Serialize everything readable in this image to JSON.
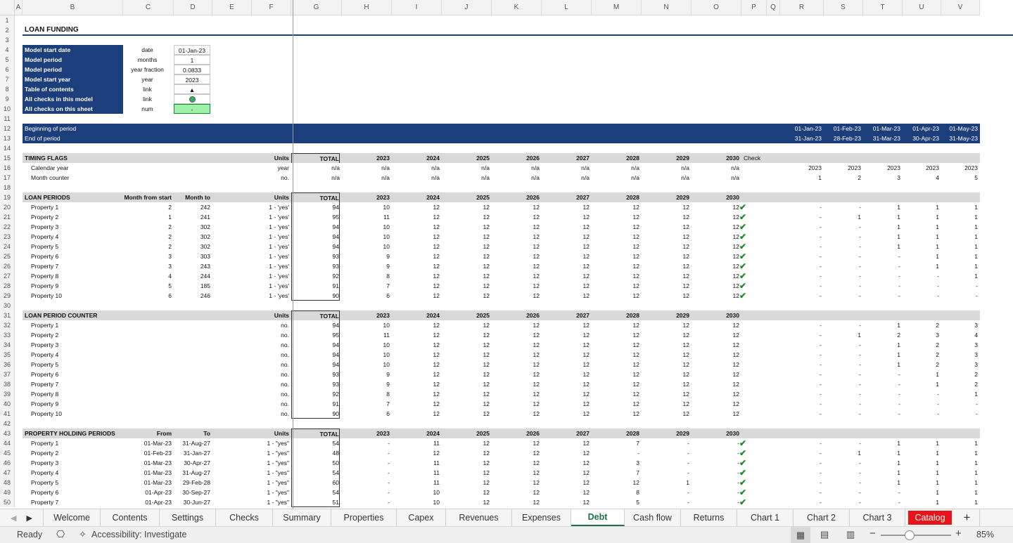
{
  "columns": [
    {
      "label": "A",
      "w": 11
    },
    {
      "label": "B",
      "w": 143
    },
    {
      "label": "C",
      "w": 72
    },
    {
      "label": "D",
      "w": 55
    },
    {
      "label": "E",
      "w": 56
    },
    {
      "label": "F",
      "w": 56
    },
    {
      "label": "G",
      "w": 72
    },
    {
      "label": "H",
      "w": 71
    },
    {
      "label": "I",
      "w": 71
    },
    {
      "label": "J",
      "w": 71
    },
    {
      "label": "K",
      "w": 71
    },
    {
      "label": "L",
      "w": 71
    },
    {
      "label": "M",
      "w": 71
    },
    {
      "label": "N",
      "w": 71
    },
    {
      "label": "O",
      "w": 71
    },
    {
      "label": "P",
      "w": 36
    },
    {
      "label": "Q",
      "w": 19
    },
    {
      "label": "R",
      "w": 62
    },
    {
      "label": "S",
      "w": 56
    },
    {
      "label": "T",
      "w": 56
    },
    {
      "label": "U",
      "w": 55
    },
    {
      "label": "V",
      "w": 55
    }
  ],
  "title": "LOAN FUNDING",
  "model_info": [
    {
      "label": "Model start date",
      "unit": "date",
      "value": "01-Jan-23"
    },
    {
      "label": "Model period",
      "unit": "months",
      "value": "1"
    },
    {
      "label": "Model period",
      "unit": "year fraction",
      "value": "0.0833"
    },
    {
      "label": "Model start year",
      "unit": "year",
      "value": "2023"
    },
    {
      "label": "Table of contents",
      "unit": "link",
      "value": "▲"
    },
    {
      "label": "All checks in this model",
      "unit": "link",
      "value": ""
    },
    {
      "label": "All checks on this sheet",
      "unit": "num",
      "value": "-"
    }
  ],
  "period_rows": {
    "begin_label": "Beginning of period",
    "end_label": "End of period",
    "begin": [
      "01-Jan-23",
      "01-Feb-23",
      "01-Mar-23",
      "01-Apr-23",
      "01-May-23"
    ],
    "end": [
      "31-Jan-23",
      "28-Feb-23",
      "31-Mar-23",
      "30-Apr-23",
      "31-May-23"
    ]
  },
  "years": [
    "2023",
    "2024",
    "2025",
    "2026",
    "2027",
    "2028",
    "2029",
    "2030"
  ],
  "labels": {
    "units": "Units",
    "total": "TOTAL",
    "check": "Check"
  },
  "timing": {
    "title": "TIMING FLAGS",
    "rows": [
      {
        "name": "Calendar year",
        "unit": "year",
        "total": "n/a",
        "vals": [
          "n/a",
          "n/a",
          "n/a",
          "n/a",
          "n/a",
          "n/a",
          "n/a",
          "n/a"
        ],
        "monthly": [
          "2023",
          "2023",
          "2023",
          "2023",
          "2023"
        ]
      },
      {
        "name": "Month counter",
        "unit": "no.",
        "total": "n/a",
        "vals": [
          "n/a",
          "n/a",
          "n/a",
          "n/a",
          "n/a",
          "n/a",
          "n/a",
          "n/a"
        ],
        "monthly": [
          "1",
          "2",
          "3",
          "4",
          "5"
        ]
      }
    ]
  },
  "loan_periods": {
    "title": "LOAN PERIODS",
    "col_c": "Month from start",
    "col_d": "Month to",
    "rows": [
      {
        "name": "Property 1",
        "c": "2",
        "d": "242",
        "unit": "1 - 'yes'",
        "total": "94",
        "vals": [
          "10",
          "12",
          "12",
          "12",
          "12",
          "12",
          "12",
          "12"
        ],
        "monthly": [
          "-",
          "-",
          "1",
          "1",
          "1"
        ]
      },
      {
        "name": "Property 2",
        "c": "1",
        "d": "241",
        "unit": "1 - 'yes'",
        "total": "95",
        "vals": [
          "11",
          "12",
          "12",
          "12",
          "12",
          "12",
          "12",
          "12"
        ],
        "monthly": [
          "-",
          "1",
          "1",
          "1",
          "1"
        ]
      },
      {
        "name": "Property 3",
        "c": "2",
        "d": "302",
        "unit": "1 - 'yes'",
        "total": "94",
        "vals": [
          "10",
          "12",
          "12",
          "12",
          "12",
          "12",
          "12",
          "12"
        ],
        "monthly": [
          "-",
          "-",
          "1",
          "1",
          "1"
        ]
      },
      {
        "name": "Property 4",
        "c": "2",
        "d": "302",
        "unit": "1 - 'yes'",
        "total": "94",
        "vals": [
          "10",
          "12",
          "12",
          "12",
          "12",
          "12",
          "12",
          "12"
        ],
        "monthly": [
          "-",
          "-",
          "1",
          "1",
          "1"
        ]
      },
      {
        "name": "Property 5",
        "c": "2",
        "d": "302",
        "unit": "1 - 'yes'",
        "total": "94",
        "vals": [
          "10",
          "12",
          "12",
          "12",
          "12",
          "12",
          "12",
          "12"
        ],
        "monthly": [
          "-",
          "-",
          "1",
          "1",
          "1"
        ]
      },
      {
        "name": "Property 6",
        "c": "3",
        "d": "303",
        "unit": "1 - 'yes'",
        "total": "93",
        "vals": [
          "9",
          "12",
          "12",
          "12",
          "12",
          "12",
          "12",
          "12"
        ],
        "monthly": [
          "-",
          "-",
          "-",
          "1",
          "1"
        ]
      },
      {
        "name": "Property 7",
        "c": "3",
        "d": "243",
        "unit": "1 - 'yes'",
        "total": "93",
        "vals": [
          "9",
          "12",
          "12",
          "12",
          "12",
          "12",
          "12",
          "12"
        ],
        "monthly": [
          "-",
          "-",
          "-",
          "1",
          "1"
        ]
      },
      {
        "name": "Property 8",
        "c": "4",
        "d": "244",
        "unit": "1 - 'yes'",
        "total": "92",
        "vals": [
          "8",
          "12",
          "12",
          "12",
          "12",
          "12",
          "12",
          "12"
        ],
        "monthly": [
          "-",
          "-",
          "-",
          "-",
          "1"
        ]
      },
      {
        "name": "Property 9",
        "c": "5",
        "d": "185",
        "unit": "1 - 'yes'",
        "total": "91",
        "vals": [
          "7",
          "12",
          "12",
          "12",
          "12",
          "12",
          "12",
          "12"
        ],
        "monthly": [
          "-",
          "-",
          "-",
          "-",
          "-"
        ]
      },
      {
        "name": "Property 10",
        "c": "6",
        "d": "246",
        "unit": "1 - 'yes'",
        "total": "90",
        "vals": [
          "6",
          "12",
          "12",
          "12",
          "12",
          "12",
          "12",
          "12"
        ],
        "monthly": [
          "-",
          "-",
          "-",
          "-",
          "-"
        ]
      }
    ]
  },
  "loan_counter": {
    "title": "LOAN PERIOD COUNTER",
    "rows": [
      {
        "name": "Property 1",
        "unit": "no.",
        "total": "94",
        "vals": [
          "10",
          "12",
          "12",
          "12",
          "12",
          "12",
          "12",
          "12"
        ],
        "monthly": [
          "-",
          "-",
          "1",
          "2",
          "3"
        ]
      },
      {
        "name": "Property 2",
        "unit": "no.",
        "total": "95",
        "vals": [
          "11",
          "12",
          "12",
          "12",
          "12",
          "12",
          "12",
          "12"
        ],
        "monthly": [
          "-",
          "1",
          "2",
          "3",
          "4"
        ]
      },
      {
        "name": "Property 3",
        "unit": "no.",
        "total": "94",
        "vals": [
          "10",
          "12",
          "12",
          "12",
          "12",
          "12",
          "12",
          "12"
        ],
        "monthly": [
          "-",
          "-",
          "1",
          "2",
          "3"
        ]
      },
      {
        "name": "Property 4",
        "unit": "no.",
        "total": "94",
        "vals": [
          "10",
          "12",
          "12",
          "12",
          "12",
          "12",
          "12",
          "12"
        ],
        "monthly": [
          "-",
          "-",
          "1",
          "2",
          "3"
        ]
      },
      {
        "name": "Property 5",
        "unit": "no.",
        "total": "94",
        "vals": [
          "10",
          "12",
          "12",
          "12",
          "12",
          "12",
          "12",
          "12"
        ],
        "monthly": [
          "-",
          "-",
          "1",
          "2",
          "3"
        ]
      },
      {
        "name": "Property 6",
        "unit": "no.",
        "total": "93",
        "vals": [
          "9",
          "12",
          "12",
          "12",
          "12",
          "12",
          "12",
          "12"
        ],
        "monthly": [
          "-",
          "-",
          "-",
          "1",
          "2"
        ]
      },
      {
        "name": "Property 7",
        "unit": "no.",
        "total": "93",
        "vals": [
          "9",
          "12",
          "12",
          "12",
          "12",
          "12",
          "12",
          "12"
        ],
        "monthly": [
          "-",
          "-",
          "-",
          "1",
          "2"
        ]
      },
      {
        "name": "Property 8",
        "unit": "no.",
        "total": "92",
        "vals": [
          "8",
          "12",
          "12",
          "12",
          "12",
          "12",
          "12",
          "12"
        ],
        "monthly": [
          "-",
          "-",
          "-",
          "-",
          "1"
        ]
      },
      {
        "name": "Property 9",
        "unit": "no.",
        "total": "91",
        "vals": [
          "7",
          "12",
          "12",
          "12",
          "12",
          "12",
          "12",
          "12"
        ],
        "monthly": [
          "-",
          "-",
          "-",
          "-",
          "-"
        ]
      },
      {
        "name": "Property 10",
        "unit": "no.",
        "total": "90",
        "vals": [
          "6",
          "12",
          "12",
          "12",
          "12",
          "12",
          "12",
          "12"
        ],
        "monthly": [
          "-",
          "-",
          "-",
          "-",
          "-"
        ]
      }
    ]
  },
  "holding": {
    "title": "PROPERTY HOLDING PERIODS",
    "col_c": "From",
    "col_d": "To",
    "rows": [
      {
        "name": "Property 1",
        "c": "01-Mar-23",
        "d": "31-Aug-27",
        "unit": "1 - \"yes\"",
        "total": "54",
        "vals": [
          "-",
          "11",
          "12",
          "12",
          "12",
          "7",
          "-",
          "-"
        ],
        "monthly": [
          "-",
          "-",
          "1",
          "1",
          "1"
        ]
      },
      {
        "name": "Property 2",
        "c": "01-Feb-23",
        "d": "31-Jan-27",
        "unit": "1 - \"yes\"",
        "total": "48",
        "vals": [
          "-",
          "12",
          "12",
          "12",
          "12",
          "-",
          "-",
          "-"
        ],
        "monthly": [
          "-",
          "1",
          "1",
          "1",
          "1"
        ]
      },
      {
        "name": "Property 3",
        "c": "01-Mar-23",
        "d": "30-Apr-27",
        "unit": "1 - \"yes\"",
        "total": "50",
        "vals": [
          "-",
          "11",
          "12",
          "12",
          "12",
          "3",
          "-",
          "-"
        ],
        "monthly": [
          "-",
          "-",
          "1",
          "1",
          "1"
        ]
      },
      {
        "name": "Property 4",
        "c": "01-Mar-23",
        "d": "31-Aug-27",
        "unit": "1 - \"yes\"",
        "total": "54",
        "vals": [
          "-",
          "11",
          "12",
          "12",
          "12",
          "7",
          "-",
          "-"
        ],
        "monthly": [
          "-",
          "-",
          "1",
          "1",
          "1"
        ]
      },
      {
        "name": "Property 5",
        "c": "01-Mar-23",
        "d": "29-Feb-28",
        "unit": "1 - \"yes\"",
        "total": "60",
        "vals": [
          "-",
          "11",
          "12",
          "12",
          "12",
          "12",
          "1",
          "-"
        ],
        "monthly": [
          "-",
          "-",
          "1",
          "1",
          "1"
        ]
      },
      {
        "name": "Property 6",
        "c": "01-Apr-23",
        "d": "30-Sep-27",
        "unit": "1 - \"yes\"",
        "total": "54",
        "vals": [
          "-",
          "10",
          "12",
          "12",
          "12",
          "8",
          "-",
          "-"
        ],
        "monthly": [
          "-",
          "-",
          "-",
          "1",
          "1"
        ]
      },
      {
        "name": "Property 7",
        "c": "01-Apr-23",
        "d": "30-Jun-27",
        "unit": "1 - \"yes\"",
        "total": "51",
        "vals": [
          "-",
          "10",
          "12",
          "12",
          "12",
          "5",
          "-",
          "-"
        ],
        "monthly": [
          "-",
          "-",
          "-",
          "1",
          "1"
        ]
      }
    ]
  },
  "tabs": [
    "Welcome",
    "Contents",
    "Settings",
    "Checks",
    "Summary",
    "Properties",
    "Capex",
    "Revenues",
    "Expenses",
    "Debt",
    "Cash flow",
    "Returns",
    "Chart 1",
    "Chart 2",
    "Chart 3",
    "Catalog"
  ],
  "active_tab": "Debt",
  "add_sheet": "+",
  "status": {
    "ready": "Ready",
    "accessibility": "Accessibility: Investigate",
    "zoom": "85%"
  },
  "colors": {
    "accent": "#1c3f7c",
    "check": "#1b8a2e",
    "catalog": "#e8141a",
    "green_cell": "#9ff0a8"
  }
}
